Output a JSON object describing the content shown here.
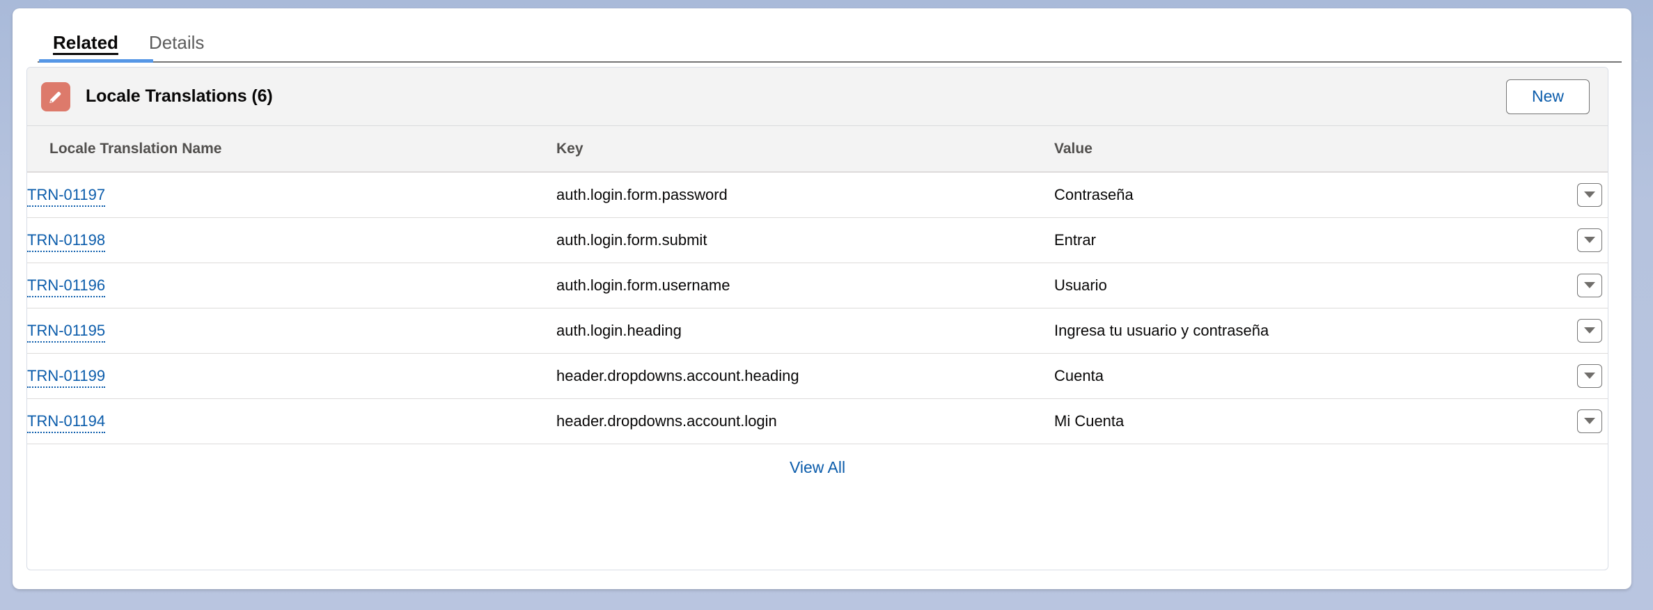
{
  "theme": {
    "background_color": "#b3c1dd",
    "card_background": "#ffffff",
    "accent_blue": "#5596e6",
    "link_blue": "#0b5cab",
    "icon_tile_color": "#dd7a6b",
    "header_gray": "#f3f3f3",
    "border_gray": "#dddbda"
  },
  "tabs": [
    {
      "label": "Related",
      "active": true
    },
    {
      "label": "Details",
      "active": false
    }
  ],
  "related_list": {
    "icon": "pencil-icon",
    "title": "Locale Translations (6)",
    "new_button_label": "New",
    "columns": [
      {
        "label": "Locale Translation Name"
      },
      {
        "label": "Key"
      },
      {
        "label": "Value"
      },
      {
        "label": ""
      }
    ],
    "rows": [
      {
        "name": "TRN-01197",
        "key": "auth.login.form.password",
        "value": "Contraseña",
        "menu_icon": "chevron-down-icon"
      },
      {
        "name": "TRN-01198",
        "key": "auth.login.form.submit",
        "value": "Entrar",
        "menu_icon": "chevron-down-icon"
      },
      {
        "name": "TRN-01196",
        "key": "auth.login.form.username",
        "value": "Usuario",
        "menu_icon": "chevron-down-icon"
      },
      {
        "name": "TRN-01195",
        "key": "auth.login.heading",
        "value": "Ingresa tu usuario y contraseña",
        "menu_icon": "chevron-down-icon"
      },
      {
        "name": "TRN-01199",
        "key": "header.dropdowns.account.heading",
        "value": "Cuenta",
        "menu_icon": "chevron-down-icon"
      },
      {
        "name": "TRN-01194",
        "key": "header.dropdowns.account.login",
        "value": "Mi Cuenta",
        "menu_icon": "chevron-down-icon"
      }
    ],
    "footer_link_label": "View All"
  }
}
